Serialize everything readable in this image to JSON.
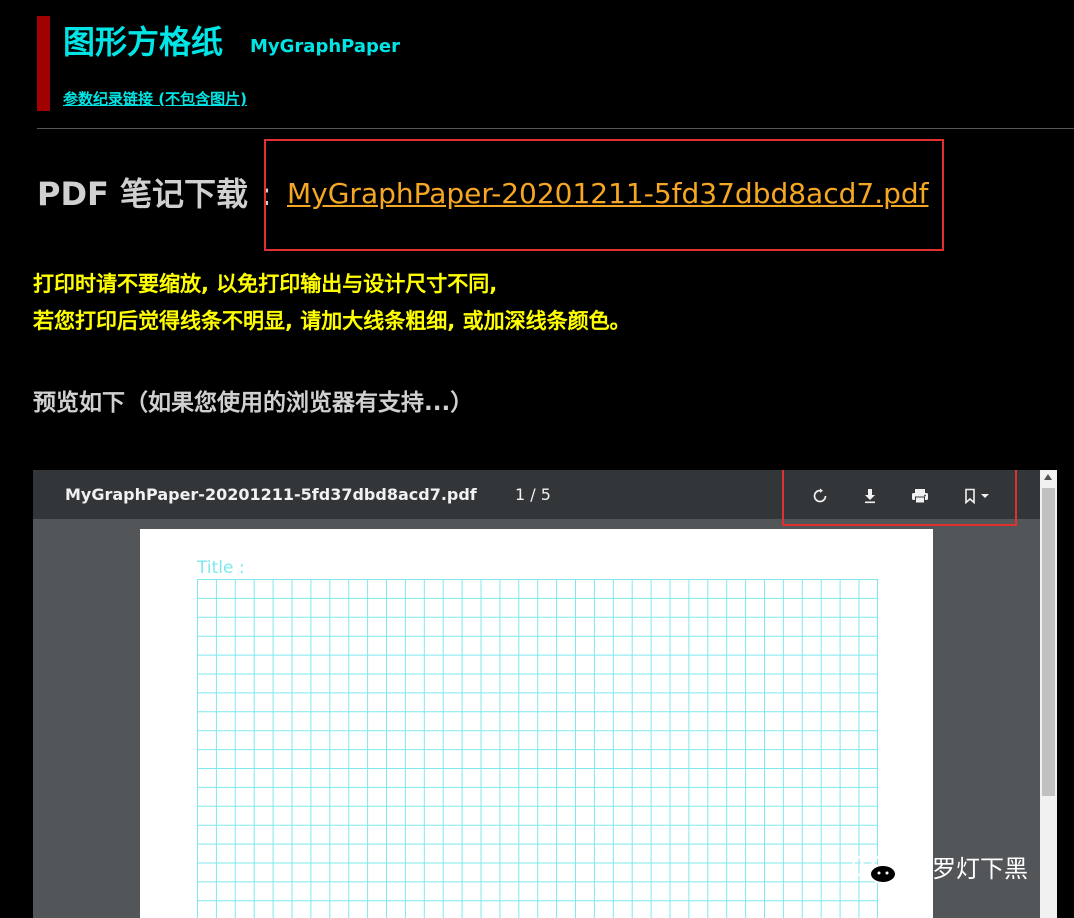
{
  "header": {
    "title_cn": "图形方格纸",
    "title_en": "MyGraphPaper",
    "param_link": "参数纪录链接 (不包含图片)"
  },
  "download": {
    "label": "PDF 笔记下载",
    "colon": ":",
    "filename": "MyGraphPaper-20201211-5fd37dbd8acd7.pdf"
  },
  "notice": {
    "line1": "打印时请不要缩放, 以免打印输出与设计尺寸不同,",
    "line2": "若您打印后觉得线条不明显, 请加大线条粗细, 或加深线条颜色。"
  },
  "preview_note": "预览如下（如果您使用的浏览器有支持...）",
  "viewer": {
    "filename": "MyGraphPaper-20201211-5fd37dbd8acd7.pdf",
    "page_indicator": "1 / 5",
    "current_page": 1,
    "total_pages": 5,
    "toolbar_icons": [
      "rotate-icon",
      "download-icon",
      "print-icon",
      "bookmark-icon"
    ]
  },
  "page": {
    "title_label": "Title :"
  },
  "watermark": {
    "text": "网罗灯下黑"
  },
  "colors": {
    "accent_bar": "#a00000",
    "cyan": "#00e5e5",
    "link_orange": "#f5a623",
    "notice_yellow": "#ffff00",
    "highlight_red": "#e03030",
    "grid_line": "#7ee8ee"
  }
}
